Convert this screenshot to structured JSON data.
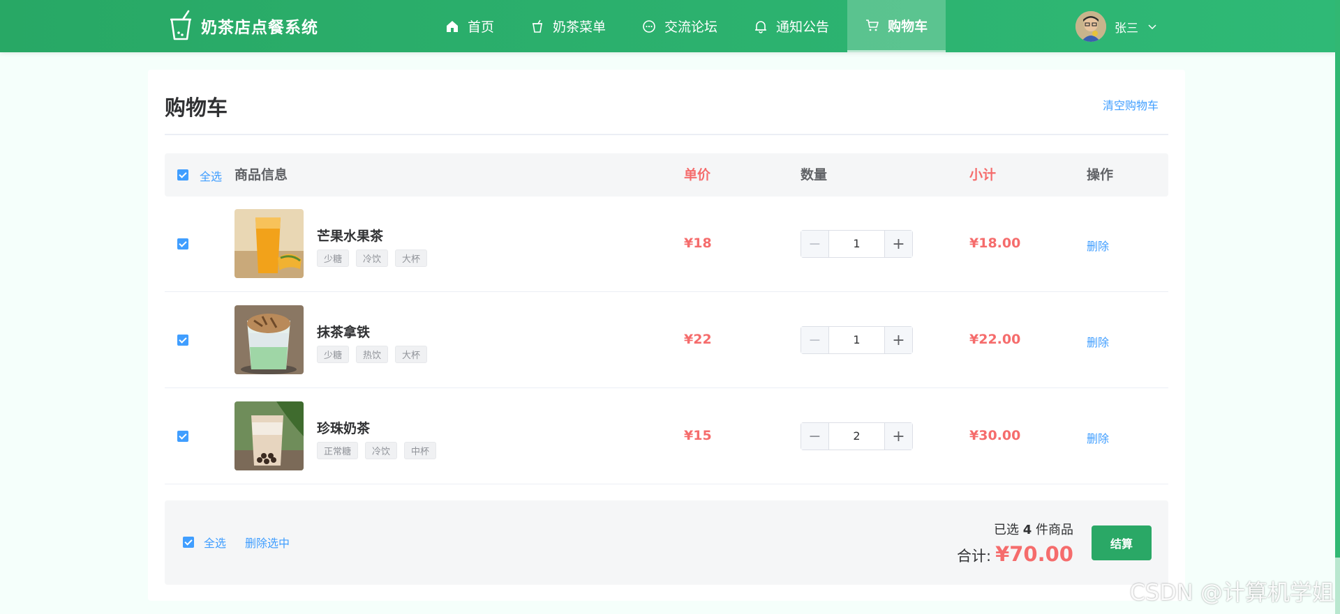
{
  "header": {
    "app_title": "奶茶店点餐系统",
    "nav": [
      {
        "label": "首页",
        "icon": "home-icon"
      },
      {
        "label": "奶茶菜单",
        "icon": "cup-icon"
      },
      {
        "label": "交流论坛",
        "icon": "chat-icon"
      },
      {
        "label": "通知公告",
        "icon": "bell-icon"
      },
      {
        "label": "购物车",
        "icon": "cart-icon",
        "active": true
      }
    ],
    "user": {
      "name": "张三"
    }
  },
  "cart": {
    "title": "购物车",
    "clear_label": "清空购物车",
    "columns": {
      "select_all": "全选",
      "info": "商品信息",
      "price": "单价",
      "qty": "数量",
      "subtotal": "小计",
      "action": "操作"
    },
    "items": [
      {
        "name": "芒果水果茶",
        "tags": [
          "少糖",
          "冷饮",
          "大杯"
        ],
        "price": "¥18",
        "qty": "1",
        "subtotal": "¥18.00",
        "action": "删除",
        "checked": true
      },
      {
        "name": "抹茶拿铁",
        "tags": [
          "少糖",
          "热饮",
          "大杯"
        ],
        "price": "¥22",
        "qty": "1",
        "subtotal": "¥22.00",
        "action": "删除",
        "checked": true
      },
      {
        "name": "珍珠奶茶",
        "tags": [
          "正常糖",
          "冷饮",
          "中杯"
        ],
        "price": "¥15",
        "qty": "2",
        "subtotal": "¥30.00",
        "action": "删除",
        "checked": true
      }
    ],
    "footer": {
      "select_all": "全选",
      "delete_selected": "删除选中",
      "count_prefix": "已选 ",
      "count": "4",
      "count_suffix": " 件商品",
      "total_label": "合计:",
      "total_value": "¥70.00",
      "checkout": "结算"
    }
  },
  "watermark": "CSDN @计算机学姐",
  "colors": {
    "header_green": "#2aad6b",
    "accent_blue": "#409eff",
    "price_red": "#f56c6c",
    "checkout_green": "#2aa866"
  }
}
